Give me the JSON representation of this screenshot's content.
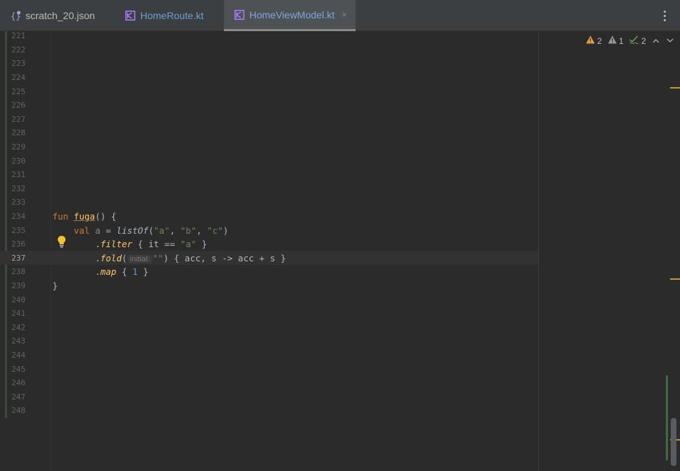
{
  "tabs": [
    {
      "label": "scratch_20.json",
      "icon": "json-file-icon"
    },
    {
      "label": "HomeRoute.kt",
      "icon": "kotlin-file-icon"
    },
    {
      "label": "HomeViewModel.kt",
      "icon": "kotlin-file-icon",
      "active": true,
      "close": "×"
    }
  ],
  "inspections": {
    "warnings": "2",
    "weak_warnings": "1",
    "typos": "2"
  },
  "editor": {
    "line_numbers": [
      "221",
      "222",
      "223",
      "224",
      "225",
      "226",
      "227",
      "228",
      "229",
      "230",
      "231",
      "232",
      "233",
      "234",
      "235",
      "236",
      "237",
      "238",
      "239",
      "240",
      "241",
      "242",
      "243",
      "244",
      "245",
      "246",
      "247",
      "248"
    ],
    "current_line": "237",
    "code": {
      "l234": {
        "kw": "fun",
        "name": "fuga",
        "rest": "() {"
      },
      "l235": {
        "kw": "val",
        "name": "a",
        "eq": " = ",
        "call": "listOf",
        "open": "(",
        "s1": "\"a\"",
        "c1": ", ",
        "s2": "\"b\"",
        "c2": ", ",
        "s3": "\"c\"",
        "close": ")"
      },
      "l236": {
        "dot": ".",
        "call": "filter",
        "pre": " { it == ",
        "str": "\"a\"",
        "post": " }"
      },
      "l237": {
        "dot": ".",
        "call": "fold",
        "open": "(",
        "hint": "initial:",
        "str": "\"\"",
        "rest": ") { acc, s -> acc + s }"
      },
      "l238": {
        "dot": ".",
        "call": "map",
        "pre": " { ",
        "num": "1",
        "post": " }"
      },
      "l239": {
        "close": "}"
      }
    }
  },
  "colors": {
    "background": "#2b2b2b",
    "keyword": "#cc7832",
    "function": "#ffc66d",
    "string": "#6a8759",
    "number": "#6897bb",
    "warning": "#c49a2a"
  }
}
